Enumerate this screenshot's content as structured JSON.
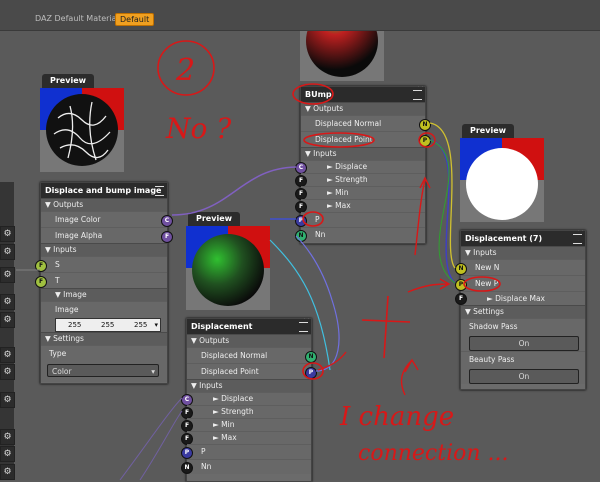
{
  "topbar": {
    "material": "DAZ Default Material",
    "badge": "Default"
  },
  "left_buttons": [
    "⚙",
    "⚙",
    "⚙",
    "⚙",
    "⚙",
    "⚙",
    "⚙",
    "⚙",
    "⚙",
    "⚙",
    "⚙"
  ],
  "preview_left": {
    "tab": "Preview"
  },
  "preview_mid": {
    "tab": "Preview"
  },
  "preview_right": {
    "tab": "Preview"
  },
  "node_displace_bump": {
    "title": "Displace and bump image",
    "outputs_label": "Outputs",
    "outputs": [
      "Image Color",
      "Image Alpha"
    ],
    "inputs_label": "Inputs",
    "inputs": [
      "S",
      "T"
    ],
    "image_label": "Image",
    "image_sub": "Image",
    "image_values": [
      "255",
      "255",
      "255"
    ],
    "settings_label": "Settings",
    "type_label": "Type",
    "type_value": "Color"
  },
  "node_bump": {
    "title": "BUmp",
    "outputs_label": "Outputs",
    "outputs": [
      "Displaced Normal",
      "Displaced Point"
    ],
    "inputs_label": "Inputs",
    "inputs": [
      "Displace",
      "Strength",
      "Min",
      "Max"
    ],
    "extra": [
      "P",
      "Nn"
    ]
  },
  "node_displacement": {
    "title": "Displacement",
    "outputs_label": "Outputs",
    "outputs": [
      "Displaced Normal",
      "Displaced Point"
    ],
    "inputs_label": "Inputs",
    "inputs": [
      "Displace",
      "Strength",
      "Min",
      "Max"
    ],
    "extra": [
      "P",
      "Nn"
    ]
  },
  "node_displacement7": {
    "title": "Displacement (7)",
    "inputs_label": "Inputs",
    "inputs": [
      "New N",
      "New P"
    ],
    "displace_max": "Displace Max",
    "settings_label": "Settings",
    "shadow_pass": "Shadow Pass",
    "beauty_pass": "Beauty Pass",
    "on": "On"
  },
  "annotations": {
    "two": "2",
    "no": "No ?",
    "i_change": "I change",
    "connection": "connection ..."
  },
  "colors": {
    "annotation": "#d81818",
    "badge": "#f0a020",
    "header": "#2b2b2b"
  }
}
